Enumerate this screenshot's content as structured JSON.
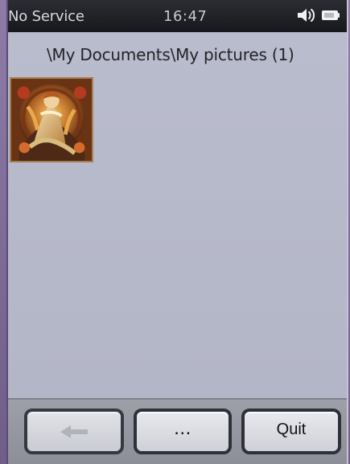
{
  "status_bar": {
    "carrier": "No Service",
    "time": "16:47",
    "icons": [
      "speaker-icon",
      "battery-icon"
    ]
  },
  "browser": {
    "path": "\\My Documents\\My pictures (1)"
  },
  "files": [
    {
      "name": "art-nouveau-picture-thumbnail",
      "icon": "picture-thumbnail"
    }
  ],
  "actions": {
    "back": {
      "icon": "back-arrow-icon"
    },
    "more_label": "...",
    "quit_label": "Quit"
  },
  "colors": {
    "status_bar": "#1f2126",
    "content_bg": "#b7bacb",
    "bottom_bar": "#959799",
    "button_face": "#dcdde4",
    "button_border": "#2f3138",
    "purple_frame": "#8b7aa6"
  }
}
